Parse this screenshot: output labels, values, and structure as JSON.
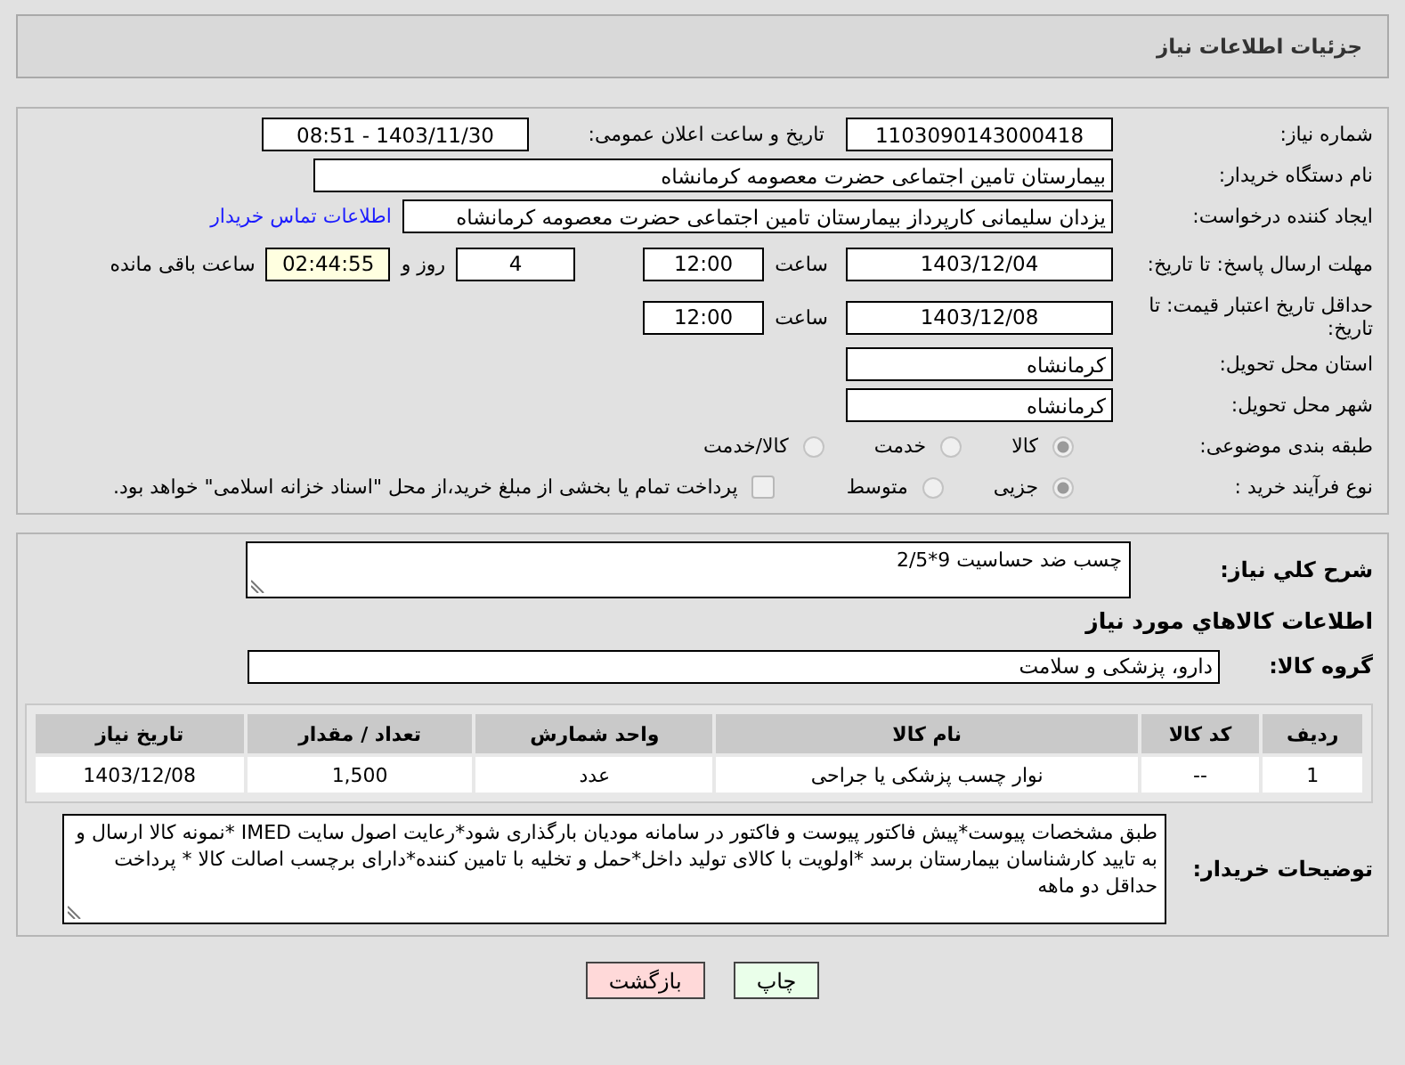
{
  "header": {
    "title": "جزئیات اطلاعات نیاز"
  },
  "need_number": {
    "label": "شماره نیاز:",
    "value": "1103090143000418"
  },
  "announce": {
    "label": "تاریخ و ساعت اعلان عمومی:",
    "value": "1403/11/30 - 08:51"
  },
  "buyer": {
    "label": "نام دستگاه خریدار:",
    "value": "بیمارستان تامین اجتماعی حضرت معصومه کرمانشاه"
  },
  "requester": {
    "label": "ایجاد کننده درخواست:",
    "value": "یزدان  سلیمانی کارپرداز بیمارستان تامین اجتماعی حضرت معصومه کرمانشاه",
    "link": "اطلاعات تماس خریدار"
  },
  "deadline": {
    "label": "مهلت ارسال پاسخ: تا تاریخ:",
    "date": "1403/12/04",
    "time_label": "ساعت",
    "time": "12:00",
    "days": "4",
    "days_label": "روز و",
    "remaining": "02:44:55",
    "remaining_label": "ساعت باقی مانده"
  },
  "validity": {
    "label": "حداقل تاریخ اعتبار قیمت: تا تاریخ:",
    "date": "1403/12/08",
    "time_label": "ساعت",
    "time": "12:00"
  },
  "province": {
    "label": "استان محل تحویل:",
    "value": "کرمانشاه"
  },
  "city": {
    "label": "شهر محل تحویل:",
    "value": "کرمانشاه"
  },
  "category": {
    "label": "طبقه بندی موضوعی:",
    "options": [
      {
        "label": "کالا",
        "selected": true
      },
      {
        "label": "خدمت",
        "selected": false
      },
      {
        "label": "کالا/خدمت",
        "selected": false
      }
    ]
  },
  "process": {
    "label": "نوع فرآیند خرید :",
    "options": [
      {
        "label": "جزیی",
        "selected": true
      },
      {
        "label": "متوسط",
        "selected": false
      }
    ],
    "payment": {
      "checked": false,
      "text": "پرداخت تمام یا بخشی از مبلغ خرید،از محل \"اسناد خزانه اسلامی\" خواهد بود."
    }
  },
  "description": {
    "label": "شرح کلي نياز:",
    "value": "چسب ضد حساسیت 9*2/5"
  },
  "goods_heading": "اطلاعات کالاهاي مورد نياز",
  "goods_group": {
    "label": "گروه کالا:",
    "value": "دارو، پزشکی و سلامت"
  },
  "table": {
    "columns": [
      "ردیف",
      "کد کالا",
      "نام کالا",
      "واحد شمارش",
      "تعداد / مقدار",
      "تاریخ نیاز"
    ],
    "rows": [
      [
        "1",
        "--",
        "نوار چسب پزشکی یا جراحی",
        "عدد",
        "1,500",
        "1403/12/08"
      ]
    ]
  },
  "notes": {
    "label": "توضیحات خریدار:",
    "value": "طبق مشخصات پیوست*پیش فاکتور پیوست و فاکتور در سامانه مودیان بارگذاری شود*رعایت اصول سایت IMED *نمونه کالا ارسال و به تایید کارشناسان بیمارستان برسد *اولویت با کالای تولید داخل*حمل و تخلیه با تامین کننده*دارای برچسب اصالت کالا * پرداخت حداقل دو ماهه"
  },
  "buttons": [
    {
      "label": "چاپ",
      "kind": "print"
    },
    {
      "label": "بازگشت",
      "kind": "back"
    }
  ]
}
